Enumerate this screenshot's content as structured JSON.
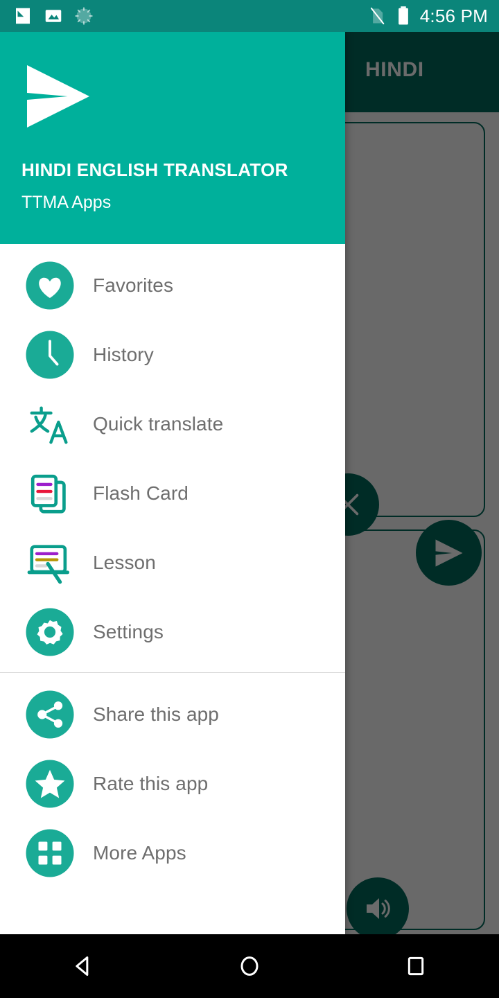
{
  "status_bar": {
    "time": "4:56 PM",
    "icons": [
      "screenshot-icon",
      "image-icon",
      "sync-spinner-icon"
    ],
    "right_icons": [
      "sim-off-icon",
      "battery-full-icon"
    ],
    "background_color": "#0b857a"
  },
  "toolbar": {
    "title": "HINDI",
    "background_color": "#00695c"
  },
  "drawer": {
    "background_color": "#ffffff",
    "header": {
      "background_color": "#00b09b",
      "logo_icon": "send-plane-logo",
      "app_name": "HINDI ENGLISH TRANSLATOR",
      "developer": "TTMA Apps"
    },
    "primary_items": [
      {
        "label": "Favorites",
        "icon": "heart-icon"
      },
      {
        "label": "History",
        "icon": "clock-icon"
      },
      {
        "label": "Quick translate",
        "icon": "translate-icon"
      },
      {
        "label": "Flash Card",
        "icon": "flash-card-icon"
      },
      {
        "label": "Lesson",
        "icon": "lesson-board-icon"
      },
      {
        "label": "Settings",
        "icon": "gear-icon"
      }
    ],
    "secondary_items": [
      {
        "label": "Share this app",
        "icon": "share-icon"
      },
      {
        "label": "Rate this app",
        "icon": "star-icon"
      },
      {
        "label": "More Apps",
        "icon": "grid-apps-icon"
      }
    ],
    "accent_color": "#1aab96"
  },
  "main_content": {
    "scrim_color": "rgba(0,0,0,0.58)",
    "source_card": {
      "name": "source-text-card"
    },
    "target_card": {
      "name": "target-text-card"
    },
    "buttons": [
      {
        "name": "clear-button",
        "icon": "close-x-icon"
      },
      {
        "name": "send-button",
        "icon": "send-plane-icon"
      },
      {
        "name": "speak-button",
        "icon": "speaker-icon"
      }
    ]
  },
  "nav_bar": {
    "background_color": "#000000",
    "buttons": [
      {
        "name": "back-button",
        "icon": "triangle-back-icon"
      },
      {
        "name": "home-button",
        "icon": "circle-home-icon"
      },
      {
        "name": "recents-button",
        "icon": "square-recents-icon"
      }
    ]
  }
}
